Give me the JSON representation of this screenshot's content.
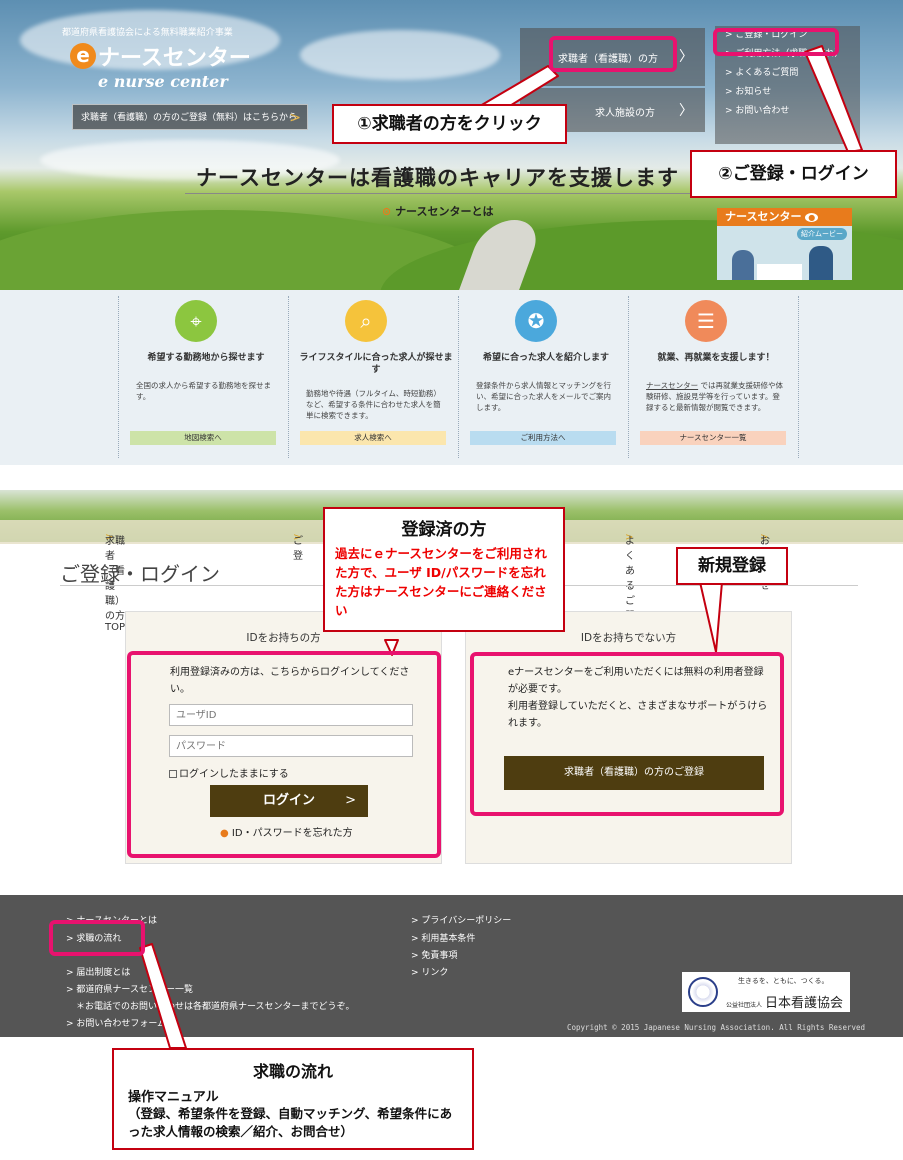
{
  "hero": {
    "tagline_small": "都道府県看護協会による無料職業紹介事業",
    "logo_e": "e",
    "logo_text": "ナースセンター",
    "logo_sub": "e nurse center",
    "register_link": "求職者（看護職）の方のご登録（無料）はこちらから",
    "nav_jobseeker": "求職者（看護職）の方",
    "nav_facility": "求人施設の方",
    "side_menu": [
      "ご登録・ログイン",
      "ご利用方法（求職の流れ）",
      "よくあるご質問",
      "お知らせ",
      "お問い合わせ"
    ],
    "title": "ナースセンターは看護職のキャリアを支援します",
    "about_link": "ナースセンターとは",
    "movie_title": "ナースセンター",
    "movie_sub": "紹介ムービー"
  },
  "features": [
    {
      "title": "希望する勤務地から探せます",
      "desc": "全国の求人から希望する勤務地を探せます。",
      "button": "地図検索へ",
      "color": "#8cc63f",
      "button_bg": "#cde3a8",
      "icon": "map-pin-icon"
    },
    {
      "title": "ライフスタイルに合った求人が探せます",
      "desc": "勤務地や待遇（フルタイム、時短勤務）など、希望する条件に合わせた求人を簡単に検索できます。",
      "button": "求人検索へ",
      "color": "#f5c33b",
      "button_bg": "#fbe6ad",
      "icon": "document-search-icon"
    },
    {
      "title": "希望に合った求人を紹介します",
      "desc": "登録条件から求人情報とマッチングを行い、希望に合った求人をメールでご案内します。",
      "button": "ご利用方法へ",
      "color": "#4ba8dc",
      "button_bg": "#b9dcf0",
      "icon": "award-icon"
    },
    {
      "title": "就業、再就業を支援します！",
      "desc_link": "ナースセンター",
      "desc": "では再就業支援研修や体験研修、施設見学等を行っています。登録すると最新情報が閲覧できます。",
      "button": "ナースセンター一覧",
      "color": "#f08a5a",
      "button_bg": "#f9d2bd",
      "icon": "id-card-hand-icon"
    }
  ],
  "subnav": {
    "items": [
      "求職者（看護職）の方 TOP",
      "ご登",
      "よくあるご質問",
      "お知らせ"
    ]
  },
  "login_page": {
    "title": "ご登録・ログイン",
    "left": {
      "heading": "IDをお持ちの方",
      "text": "利用登録済みの方は、こちらからログインしてください。",
      "user_placeholder": "ユーザID",
      "password_placeholder": "パスワード",
      "remember": "ログインしたままにする",
      "login_button": "ログイン",
      "forgot": "ID・パスワードを忘れた方"
    },
    "right": {
      "heading": "IDをお持ちでない方",
      "text1": "eナースセンターをご利用いただくには無料の利用者登録が必要です。",
      "text2": "利用者登録していただくと、さまざまなサポートがうけられます。",
      "register_button": "求職者（看護職）の方のご登録"
    }
  },
  "footer": {
    "left_links": [
      "ナースセンターとは",
      "求職の流れ",
      "",
      "届出制度とは",
      "都道府県ナースセンター一覧",
      "＊お電話でのお問い合わせは各都道府県ナースセンターまでどうぞ。",
      "お問い合わせフォーム"
    ],
    "right_links": [
      "プライバシーポリシー",
      "利用基本条件",
      "免責事項",
      "リンク"
    ],
    "org_slogan": "生きるを、ともに、つくる。",
    "org_type": "公益社団法人",
    "org_name": "日本看護協会",
    "copyright": "Copyright © 2015 Japanese Nursing Association. All Rights Reserved"
  },
  "annotations": {
    "step1": "①求職者の方をクリック",
    "step2": "②ご登録・ログイン",
    "registered_title": "登録済の方",
    "registered_body": "過去にｅナースセンターをご利用された方で、ユーザ ID/パスワードを忘れた方はナースセンターにご連絡ください",
    "new_registration": "新規登録",
    "flow_title": "求職の流れ",
    "flow_manual": "操作マニュアル",
    "flow_body": "（登録、希望条件を登録、自動マッチング、希望条件にあった求人情報の検索／紹介、お問合せ）",
    "highlight_color": "#e8126e",
    "callout_border": "#c40010"
  }
}
